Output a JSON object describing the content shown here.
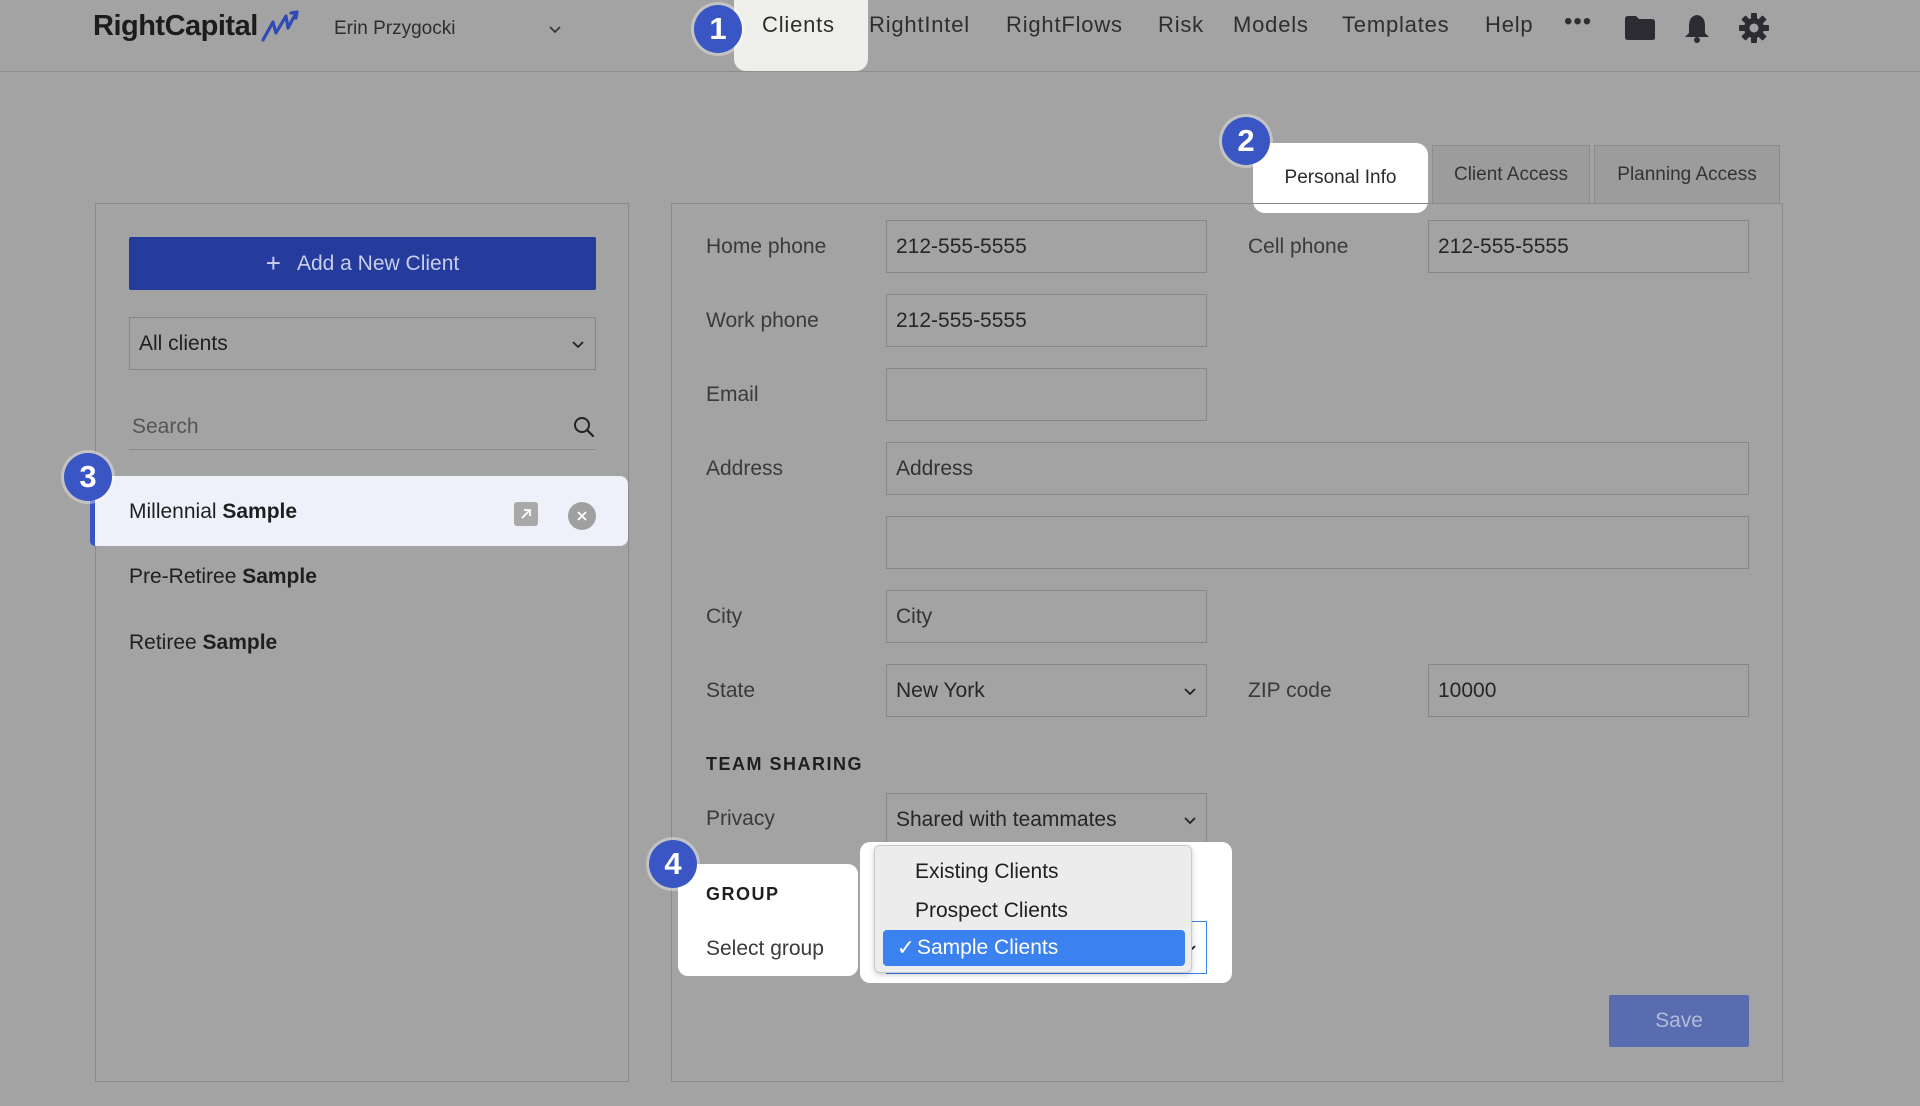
{
  "header": {
    "logo": "RightCapital",
    "user": "Erin Przygocki",
    "nav": [
      "Clients",
      "RightIntel",
      "RightFlows",
      "Risk",
      "Models",
      "Templates",
      "Help"
    ],
    "more": "•••"
  },
  "steps": [
    "1",
    "2",
    "3",
    "4"
  ],
  "tabs": [
    "Personal Info",
    "Client Access",
    "Planning Access"
  ],
  "sidebar": {
    "add_button": "Add a New Client",
    "add_plus": "+",
    "filter": "All clients",
    "search_placeholder": "Search",
    "clients": [
      {
        "first": "Millennial ",
        "last": "Sample"
      },
      {
        "first": "Pre-Retiree ",
        "last": "Sample"
      },
      {
        "first": "Retiree ",
        "last": "Sample"
      }
    ]
  },
  "form": {
    "home_phone_label": "Home phone",
    "home_phone": "212-555-5555",
    "cell_phone_label": "Cell phone",
    "cell_phone": "212-555-5555",
    "work_phone_label": "Work phone",
    "work_phone": "212-555-5555",
    "email_label": "Email",
    "email": "",
    "address_label": "Address",
    "address_placeholder": "Address",
    "address2": "",
    "city_label": "City",
    "city_placeholder": "City",
    "state_label": "State",
    "state": "New York",
    "zip_label": "ZIP code",
    "zip": "10000",
    "team_sharing_heading": "TEAM SHARING",
    "privacy_label": "Privacy",
    "privacy": "Shared with teammates",
    "group_heading": "GROUP",
    "group_label": "Select group",
    "group_options": [
      "Existing Clients",
      "Prospect Clients",
      "Sample Clients"
    ],
    "group_selected": "Sample Clients",
    "check": "✓",
    "save": "Save"
  },
  "colors": {
    "accent": "#3a55c4",
    "add_button": "#263c9c",
    "selected_option": "#3b82f0",
    "save_button": "#5a6cb0",
    "background": "#a3a3a3"
  }
}
